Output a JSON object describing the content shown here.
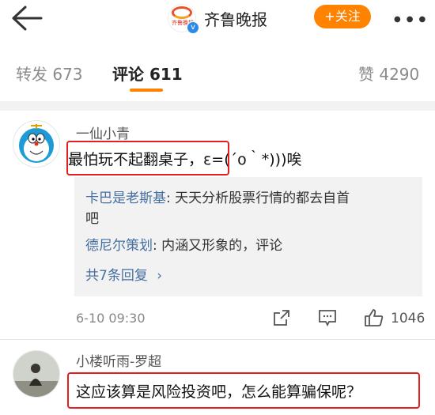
{
  "header": {
    "account_name": "齐鲁晚报",
    "logo_text": "齐鲁晚报",
    "follow_label": "+关注",
    "more_icon": "more-dots-icon"
  },
  "tabs": [
    {
      "label": "转发 673",
      "active": false
    },
    {
      "label": "评论 611",
      "active": true
    },
    {
      "label": "赞 4290",
      "active": false
    }
  ],
  "comments": [
    {
      "username": "一仙小青",
      "text_highlighted": "最怕玩不起翻桌子，",
      "text_rest": "ε=(´ο｀*)))唉",
      "replies": [
        {
          "user": "卡巴是老斯基",
          "text_line1": ": 天天分析股票行情的都去自首",
          "text_line2": "吧"
        },
        {
          "user": "德尼尔策划",
          "text_line1": ": 内涵又形象的，评论"
        }
      ],
      "more_replies": "共7条回复",
      "time": "6-10 09:30",
      "like_count": "1046"
    },
    {
      "username": "小楼听雨-罗超",
      "text": "这应该算是风险投资吧，怎么能算骗保呢？"
    }
  ],
  "colors": {
    "accent": "#ff8200",
    "link": "#456fa0",
    "highlight_box": "#e41f1f"
  }
}
